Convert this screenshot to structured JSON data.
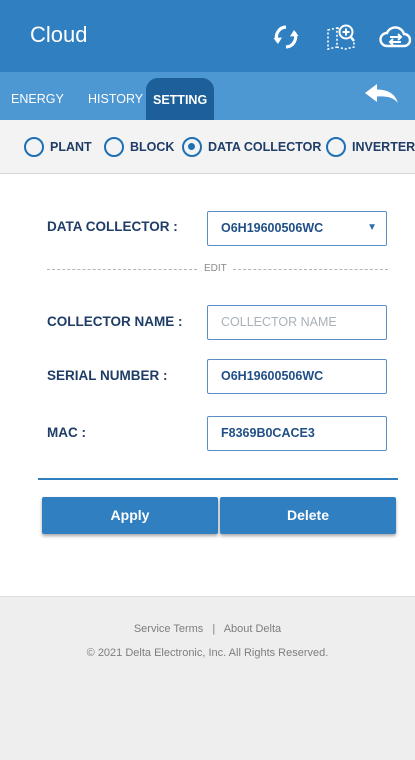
{
  "header": {
    "title": "Cloud",
    "icons": [
      "refresh-icon",
      "zoom-in-map-icon",
      "cloud-sync-icon"
    ]
  },
  "tabs": [
    {
      "label": "ENERGY",
      "active": false
    },
    {
      "label": "HISTORY",
      "active": false
    },
    {
      "label": "SETTING",
      "active": true
    }
  ],
  "scope": {
    "options": [
      "PLANT",
      "BLOCK",
      "DATA COLLECTOR",
      "INVERTER"
    ],
    "selected": "DATA COLLECTOR"
  },
  "form": {
    "collector_select": {
      "label": "DATA COLLECTOR :",
      "value": "O6H19600506WC"
    },
    "edit_label": "EDIT",
    "collector_name": {
      "label": "COLLECTOR NAME :",
      "value": "",
      "placeholder": "COLLECTOR NAME"
    },
    "serial_number": {
      "label": "SERIAL NUMBER :",
      "value": "O6H19600506WC"
    },
    "mac": {
      "label": "MAC :",
      "value": "F8369B0CACE3"
    }
  },
  "actions": {
    "apply_label": "Apply",
    "delete_label": "Delete"
  },
  "footer": {
    "service_terms": "Service Terms",
    "separator": "|",
    "about": "About Delta",
    "copyright": "© 2021 Delta Electronic, Inc. All Rights Reserved."
  },
  "colors": {
    "header": "#2f7fc1",
    "tab_bar": "#4d97d3",
    "active_tab": "#1d5f98",
    "label_text": "#1f3d66",
    "button": "#2f7fc1"
  }
}
